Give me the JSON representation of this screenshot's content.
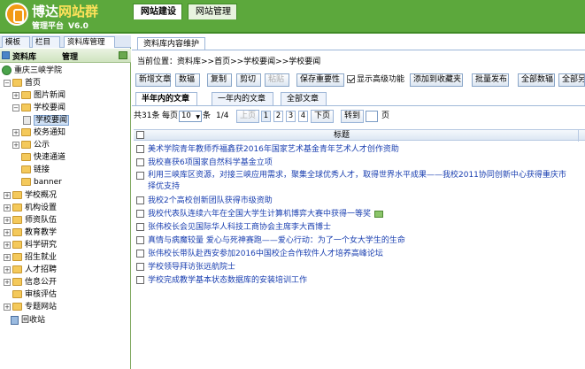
{
  "logo": {
    "name_a": "博达",
    "name_b": "网站群",
    "subtitle": "管理平台",
    "version": "V6.0"
  },
  "main_tabs": [
    "网站建设",
    "网站管理"
  ],
  "left_tabs": [
    "模板",
    "栏目",
    "资料库管理"
  ],
  "left_header": {
    "title": "资料库",
    "manage": "管理"
  },
  "tree": {
    "root": "重庆三峡学院",
    "home": "首页",
    "image_news": "图片新闻",
    "school_news": "学校要闻",
    "school_news_sel": "学校要闻",
    "notice": "校务通知",
    "public": "公示",
    "fast": "快速通道",
    "link": "链接",
    "banner": "banner",
    "overview": "学校概况",
    "org": "机构设置",
    "faculty": "师资队伍",
    "teaching": "教育教学",
    "research": "科学研究",
    "admission": "招生就业",
    "recruit": "人才招聘",
    "info": "信息公开",
    "review": "审核评估",
    "special": "专题网站",
    "recycle": "回收站"
  },
  "content": {
    "tab": "资料库内容维护",
    "location": "当前位置：资料库>>首页>>学校要闻>>学校要闻"
  },
  "toolbar": {
    "new": "新增文章",
    "copy_count": "数辐",
    "copy": "复制",
    "cut": "剪切",
    "paste": "粘贴",
    "save_importance": "保存重要性",
    "show_advanced": "显示高级功能",
    "add_favorite": "添加到收藏夹",
    "batch_publish": "批量发布",
    "all_copy": "全部数辐",
    "all_more": "全部另"
  },
  "sub_tabs": [
    "半年内的文章",
    "一年内的文章",
    "全部文章"
  ],
  "pager": {
    "total": "共31条",
    "per_page_label": "每页",
    "per_page": "10",
    "per_page_unit": "条",
    "page_info": "1/4",
    "prev": "上页",
    "pages": [
      "1",
      "2",
      "3",
      "4"
    ],
    "next": "下页",
    "goto": "转到",
    "page_unit": "页"
  },
  "grid": {
    "title_header": "标题",
    "rows": [
      "美术学院青年教师乔福鑫获2016年国家艺术基金青年艺术人才创作资助",
      "我校喜获6项国家自然科学基金立项",
      "利用三峡库区资源，对接三峡应用需求，聚集全球优秀人才，取得世界水平成果——我校2011协同创新中心获得重庆市择优支持",
      "我校2个高校创新团队获得市级资助",
      "我校代表队连续六年在全国大学生计算机博弈大赛中获得一等奖",
      "张伟校长会见国际华人科技工商协会主席李大西博士",
      "真情与病魔较量  爱心与死神赛跑——爱心行动：为了一个女大学生的生命",
      "张伟校长带队赴西安参加2016中国校企合作软件人才培养高峰论坛",
      "学校领导拜访张远航院士",
      "学校完成教学基本状态数据库的安装培训工作"
    ]
  }
}
